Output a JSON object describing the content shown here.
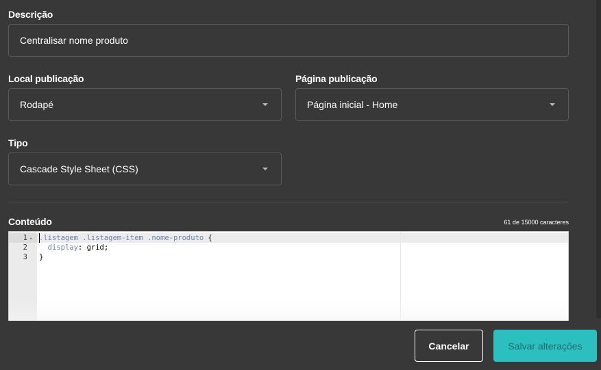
{
  "form": {
    "descricao_label": "Descrição",
    "descricao_value": "Centralisar nome produto",
    "local_label": "Local publicação",
    "local_value": "Rodapé",
    "pagina_label": "Página publicação",
    "pagina_value": "Página inicial - Home",
    "tipo_label": "Tipo",
    "tipo_value": "Cascade Style Sheet (CSS)",
    "conteudo_label": "Conteúdo",
    "char_count": "61 de 15000 caracteres"
  },
  "editor": {
    "line_numbers": [
      "1",
      "2",
      "3"
    ],
    "fold_icon": "▾",
    "line1_selector": ".listagem .listagem-item .nome-produto",
    "line1_brace": " {",
    "line2_indent": "  ",
    "line2_prop": "display",
    "line2_rest": ": grid;",
    "line3": "}"
  },
  "footer": {
    "cancel_label": "Cancelar",
    "save_label": "Salvar alterações"
  },
  "colors": {
    "background": "#383838",
    "accent": "#2bbfbf",
    "field_border": "#5a5a5a"
  }
}
